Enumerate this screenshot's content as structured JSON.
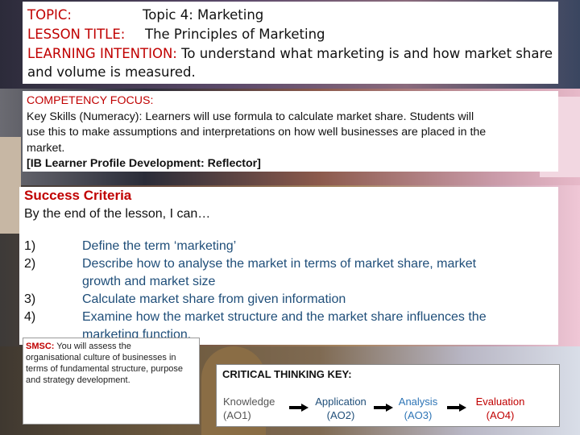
{
  "header": {
    "topic_label": "TOPIC:",
    "topic_value": "Topic 4: Marketing",
    "lesson_label": "LESSON TITLE:",
    "lesson_value": "The Principles of Marketing",
    "intention_label": "LEARNING INTENTION:",
    "intention_line1": " To understand what marketing is and how market share",
    "intention_line2": "and volume is measured."
  },
  "competency": {
    "heading": "COMPETENCY FOCUS:",
    "skills_label": "Key Skills (Numeracy):",
    "skills_line1": " Learners will use formula to calculate market share. Students will",
    "skills_line2": "use this to make assumptions and interpretations on how well businesses are placed in the",
    "skills_line3": "market.",
    "ib_line": "[IB Learner Profile Development: Reflector]"
  },
  "success": {
    "title": "Success Criteria",
    "intro": "By the end of the lesson, I can…",
    "items": [
      {
        "num": "1)",
        "line1": "Define the term ‘marketing’"
      },
      {
        "num": "2)",
        "line1": "Describe how to analyse the market in terms of market share,   market",
        "line2": "growth and market size"
      },
      {
        "num": "3)",
        "line1": "Calculate market share from given information"
      },
      {
        "num": "4)",
        "line1": "Examine how the market structure and the market share influences the",
        "line2": "marketing function."
      }
    ]
  },
  "smsc": {
    "label": "SMSC:",
    "line1": " You will assess the",
    "line2": "organisational culture of businesses in",
    "line3": "terms of fundamental structure, purpose",
    "line4": "and strategy development."
  },
  "critical": {
    "title": "CRITICAL THINKING KEY:",
    "stages": [
      {
        "name": "Knowledge",
        "code": "(AO1)",
        "color": "#555555"
      },
      {
        "name": "Application",
        "code": "(AO2)",
        "color": "#1f4e79"
      },
      {
        "name": "Analysis",
        "code": "(AO3)",
        "color": "#2e75b6"
      },
      {
        "name": "Evaluation",
        "code": "(AO4)",
        "color": "#c00000"
      }
    ]
  },
  "colors": {
    "accent_red": "#c00000",
    "criteria_blue": "#1f4e79"
  }
}
